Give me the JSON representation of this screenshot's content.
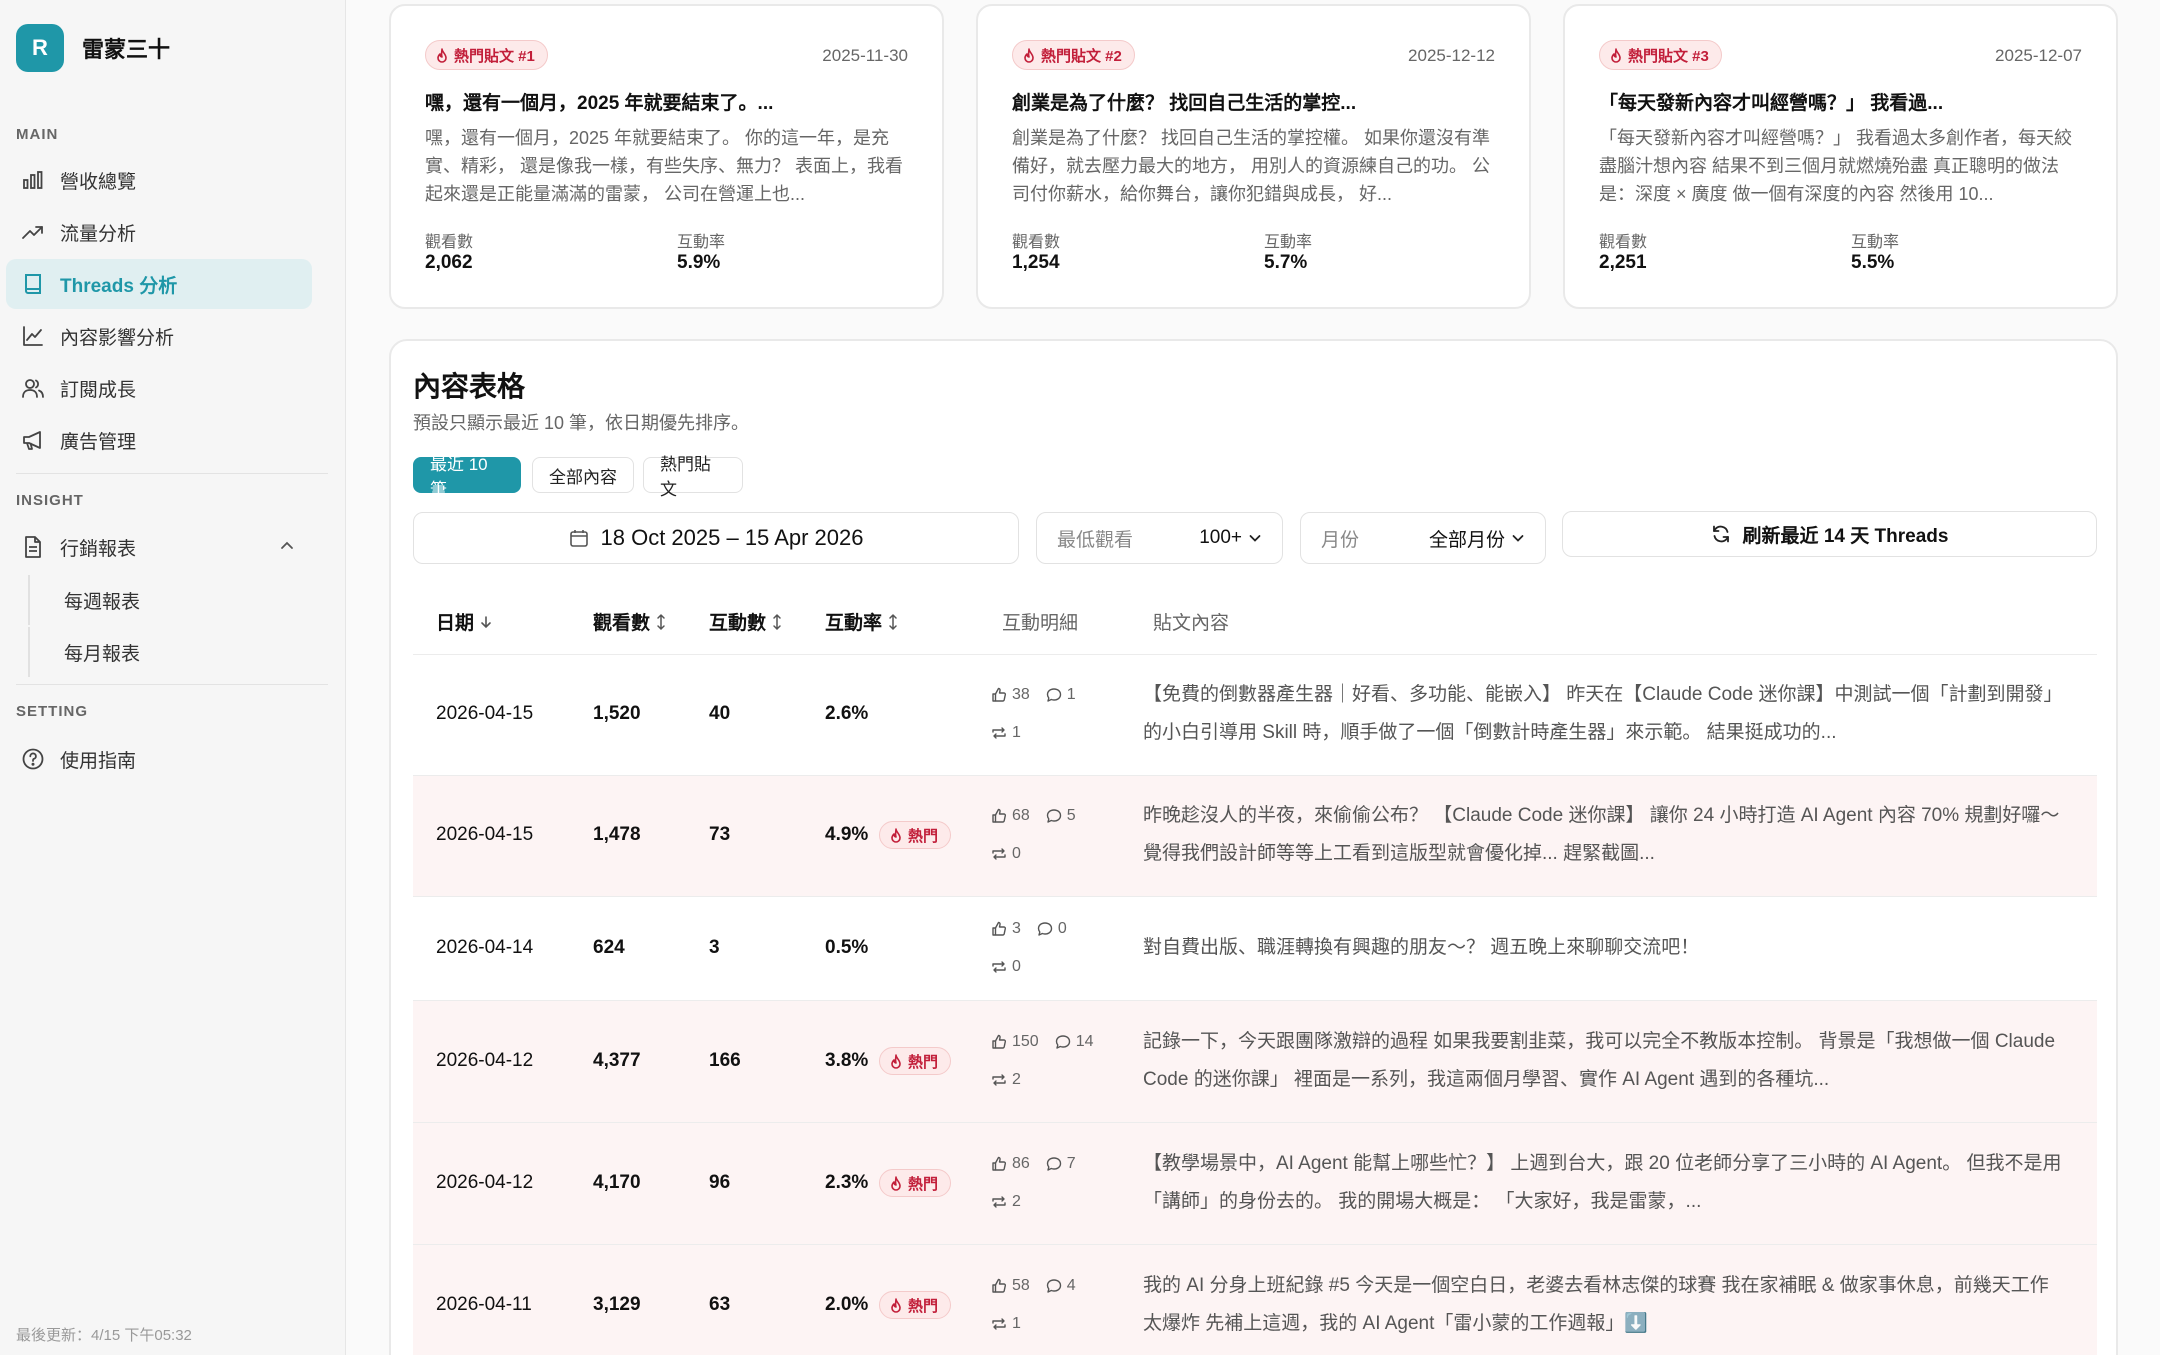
{
  "brand": {
    "initial": "R",
    "name": "雷蒙三十"
  },
  "sidebar": {
    "sections": {
      "main": "MAIN",
      "insight": "INSIGHT",
      "setting": "SETTING"
    },
    "main_items": [
      {
        "label": "營收總覽",
        "icon": "bar-chart-icon"
      },
      {
        "label": "流量分析",
        "icon": "trending-up-icon"
      },
      {
        "label": "Threads 分析",
        "icon": "book-icon",
        "active": true
      },
      {
        "label": "內容影響分析",
        "icon": "line-chart-icon"
      },
      {
        "label": "訂閱成長",
        "icon": "users-icon"
      },
      {
        "label": "廣告管理",
        "icon": "megaphone-icon"
      }
    ],
    "insight_items": {
      "reports": "行銷報表",
      "weekly": "每週報表",
      "monthly": "每月報表"
    },
    "setting_items": {
      "guide": "使用指南"
    },
    "last_updated": "最後更新：4/15 下午05:32"
  },
  "cards": [
    {
      "tag": "熱門貼文 #1",
      "date": "2025-11-30",
      "title": "嘿，還有一個月，2025 年就要結束了。...",
      "body": "嘿，還有一個月，2025 年就要結束了。 你的這一年，是充實、精彩， 還是像我一樣，有些失序、無力？ 表面上，我看起來還是正能量滿滿的雷蒙， 公司在營運上也...",
      "views_label": "觀看數",
      "views": "2,062",
      "rate_label": "互動率",
      "rate": "5.9%"
    },
    {
      "tag": "熱門貼文 #2",
      "date": "2025-12-12",
      "title": "創業是為了什麼？ 找回自己生活的掌控...",
      "body": "創業是為了什麼？ 找回自己生活的掌控權。 如果你還沒有準備好，就去壓力最大的地方， 用別人的資源練自己的功。 公司付你薪水，給你舞台，讓你犯錯與成長， 好...",
      "views_label": "觀看數",
      "views": "1,254",
      "rate_label": "互動率",
      "rate": "5.7%"
    },
    {
      "tag": "熱門貼文 #3",
      "date": "2025-12-07",
      "title": "「每天發新內容才叫經營嗎？」 我看過...",
      "body": "「每天發新內容才叫經營嗎？」 我看過太多創作者，每天絞盡腦汁想內容 結果不到三個月就燃燒殆盡 真正聰明的做法是：深度 × 廣度 做一個有深度的內容 然後用 10...",
      "views_label": "觀看數",
      "views": "2,251",
      "rate_label": "互動率",
      "rate": "5.5%"
    }
  ],
  "table": {
    "title": "內容表格",
    "subtitle": "預設只顯示最近 10 筆，依日期優先排序。",
    "filters": [
      "最近 10 筆",
      "全部內容",
      "熱門貼文"
    ],
    "date_range": "18 Oct 2025 – 15 Apr 2026",
    "min_views_label": "最低觀看",
    "min_views_value": "100+",
    "month_label": "月份",
    "month_value": "全部月份",
    "refresh_label": "刷新最近 14 天 Threads",
    "hot_badge": "熱門",
    "columns": {
      "date": "日期",
      "views": "觀看數",
      "interactions": "互動數",
      "rate": "互動率",
      "detail": "互動明細",
      "content": "貼文內容"
    },
    "rows": [
      {
        "date": "2026-04-15",
        "views": "1,520",
        "interactions": "40",
        "rate": "2.6%",
        "hot": false,
        "likes": "38",
        "comments": "1",
        "reposts": "1",
        "content": "【免費的倒數器產生器｜好看、多功能、能嵌入】 昨天在【Claude Code 迷你課】中測試一個「計劃到開發」的小白引導用 Skill 時，順手做了一個「倒數計時產生器」來示範。 結果挺成功的..."
      },
      {
        "date": "2026-04-15",
        "views": "1,478",
        "interactions": "73",
        "rate": "4.9%",
        "hot": true,
        "likes": "68",
        "comments": "5",
        "reposts": "0",
        "content": "昨晚趁沒人的半夜，來偷偷公布？ 【Claude Code 迷你課】 讓你 24 小時打造 AI Agent 內容 70% 規劃好囉～ 覺得我們設計師等等上工看到這版型就會優化掉... 趕緊截圖..."
      },
      {
        "date": "2026-04-14",
        "views": "624",
        "interactions": "3",
        "rate": "0.5%",
        "hot": false,
        "likes": "3",
        "comments": "0",
        "reposts": "0",
        "content": "對自費出版、職涯轉換有興趣的朋友～？ 週五晚上來聊聊交流吧！"
      },
      {
        "date": "2026-04-12",
        "views": "4,377",
        "interactions": "166",
        "rate": "3.8%",
        "hot": true,
        "likes": "150",
        "comments": "14",
        "reposts": "2",
        "content": "記錄一下，今天跟團隊激辯的過程 如果我要割韭菜，我可以完全不教版本控制。 背景是「我想做一個 Claude Code 的迷你課」 裡面是一系列，我這兩個月學習、實作 AI Agent 遇到的各種坑..."
      },
      {
        "date": "2026-04-12",
        "views": "4,170",
        "interactions": "96",
        "rate": "2.3%",
        "hot": true,
        "likes": "86",
        "comments": "7",
        "reposts": "2",
        "content": "【教學場景中，AI Agent 能幫上哪些忙？】 上週到台大，跟 20 位老師分享了三小時的 AI Agent。 但我不是用「講師」的身份去的。 我的開場大概是： 「大家好，我是雷蒙，..."
      },
      {
        "date": "2026-04-11",
        "views": "3,129",
        "interactions": "63",
        "rate": "2.0%",
        "hot": true,
        "likes": "58",
        "comments": "4",
        "reposts": "1",
        "content": "我的 AI 分身上班紀錄 #5 今天是一個空白日，老婆去看林志傑的球賽 我在家補眠 & 做家事休息，前幾天工作太爆炸 先補上這週，我的 AI Agent「雷小蒙的工作週報」⬇️"
      }
    ]
  },
  "colors": {
    "accent": "#1f97a8",
    "hot": "#c21f3a",
    "hot_bg": "#fdeaea",
    "hot_row": "#fdf4f4"
  }
}
